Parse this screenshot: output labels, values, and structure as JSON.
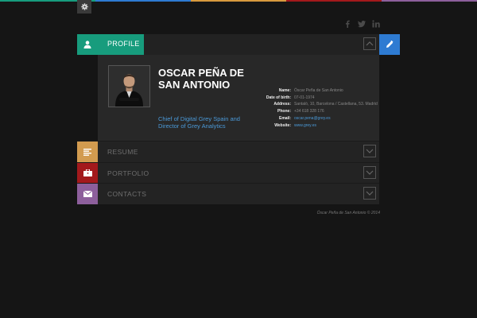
{
  "topbar_colors": [
    "#179c7d",
    "#2e7bd2",
    "#d89a3e",
    "#a3191c",
    "#8d5f9c"
  ],
  "icons": {
    "settings": "gear-icon",
    "social": [
      "facebook-icon",
      "twitter-icon",
      "linkedin-icon"
    ],
    "profile": "user-icon",
    "edit": "pencil-icon",
    "expand": "chevron-icon"
  },
  "profile": {
    "tab_label": "PROFILE",
    "name": "OSCAR PEÑA DE SAN ANTONIO",
    "role": "Chief of Digital Grey Spain and Director of Grey Analytics",
    "details": [
      {
        "key": "Name:",
        "value": "Óscar Peña de San Antonio"
      },
      {
        "key": "Date of birth:",
        "value": "07-01-1974"
      },
      {
        "key": "Address:",
        "value": "Santaló, 10, Barcelona / Castellana, 53. Madrid"
      },
      {
        "key": "Phone:",
        "value": "+34 618 328 176"
      },
      {
        "key": "Email:",
        "value": "oscar.pena@grey.es"
      },
      {
        "key": "Website:",
        "value": "www.grey.es"
      }
    ]
  },
  "sections": [
    {
      "label": "RESUME",
      "color": "#d29b4f",
      "icon": "list-icon"
    },
    {
      "label": "PORTFOLIO",
      "color": "#a3191c",
      "icon": "briefcase-icon"
    },
    {
      "label": "CONTACTS",
      "color": "#8d5f9c",
      "icon": "envelope-icon"
    }
  ],
  "footer": {
    "copyright": "Óscar Peña de San Antonio © 2014"
  }
}
